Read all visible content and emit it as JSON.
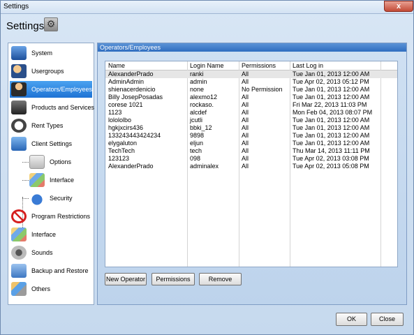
{
  "window": {
    "title": "Settings",
    "close_glyph": "x"
  },
  "header": {
    "title": "Settings",
    "icon": "gear-icon"
  },
  "sidebar": {
    "items": [
      {
        "label": "System",
        "icon": "monitor-icon"
      },
      {
        "label": "Usergroups",
        "icon": "users-icon"
      },
      {
        "label": "Operators/Employees",
        "icon": "operator-icon"
      },
      {
        "label": "Products and Services",
        "icon": "products-icon"
      },
      {
        "label": "Rent Types",
        "icon": "clock-icon"
      },
      {
        "label": "Client Settings",
        "icon": "client-icon"
      },
      {
        "label": "Options",
        "icon": "options-icon"
      },
      {
        "label": "Interface",
        "icon": "interface-icon"
      },
      {
        "label": "Security",
        "icon": "lock-icon"
      },
      {
        "label": "Program Restrictions",
        "icon": "no-entry-icon"
      },
      {
        "label": "Interface",
        "icon": "interface-icon"
      },
      {
        "label": "Sounds",
        "icon": "speaker-icon"
      },
      {
        "label": "Backup and Restore",
        "icon": "backup-icon"
      },
      {
        "label": "Others",
        "icon": "others-icon"
      }
    ]
  },
  "panel": {
    "title": "Operators/Employees",
    "columns": [
      "Name",
      "Login Name",
      "Permissions",
      "Last Log in"
    ],
    "rows": [
      [
        "AlexanderPrado",
        "ranki",
        "All",
        "Tue Jan 01, 2013 12:00 AM"
      ],
      [
        "AdminAdmin",
        "admin",
        "All",
        "Tue Apr 02, 2013 05:12 PM"
      ],
      [
        "shienacerdenicio",
        "none",
        "No Permission",
        "Tue Jan 01, 2013 12:00 AM"
      ],
      [
        "Billy JosepPosadas",
        "alexmo12",
        "All",
        "Tue Jan 01, 2013 12:00 AM"
      ],
      [
        "corese 1021",
        "rockaso.",
        "All",
        "Fri Mar 22, 2013 11:03 PM"
      ],
      [
        "1123",
        "alcdef",
        "All",
        "Mon Feb 04, 2013 08:07 PM"
      ],
      [
        "lolololbo",
        "jcutli",
        "All",
        "Tue Jan 01, 2013 12:00 AM"
      ],
      [
        "hgkjxcirs436",
        "bbki_12",
        "All",
        "Tue Jan 01, 2013 12:00 AM"
      ],
      [
        "133243443424234",
        "9898",
        "All",
        "Tue Jan 01, 2013 12:00 AM"
      ],
      [
        "elygaluton",
        "eljun",
        "All",
        "Tue Jan 01, 2013 12:00 AM"
      ],
      [
        "TechTech",
        "tech",
        "All",
        "Thu Mar 14, 2013 11:11 PM"
      ],
      [
        "123123",
        "098",
        "All",
        "Tue Apr 02, 2013 03:08 PM"
      ],
      [
        "AlexanderPrado",
        "adminalex",
        "All",
        "Tue Apr 02, 2013 05:08 PM"
      ]
    ],
    "buttons": {
      "new": "New Operator",
      "permissions": "Permissions",
      "remove": "Remove"
    }
  },
  "footer": {
    "ok": "OK",
    "close": "Close"
  }
}
